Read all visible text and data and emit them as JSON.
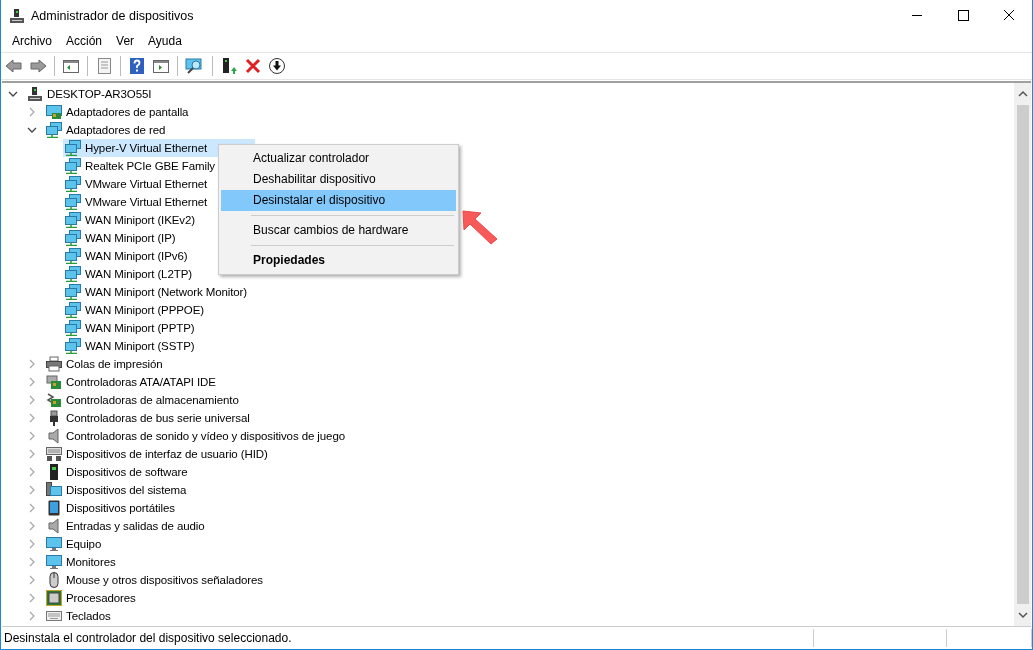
{
  "window": {
    "title": "Administrador de dispositivos"
  },
  "menu": [
    "Archivo",
    "Acción",
    "Ver",
    "Ayuda"
  ],
  "tree": {
    "label": "DESKTOP-AR3O55I",
    "kind": "computer",
    "expanded": true,
    "selected": false,
    "children": [
      {
        "label": "Adaptadores de pantalla",
        "kind": "display",
        "expanded": false,
        "selected": false
      },
      {
        "label": "Adaptadores de red",
        "kind": "network",
        "expanded": true,
        "selected": false,
        "children": [
          {
            "label": "Hyper-V Virtual Ethernet",
            "kind": "network",
            "selected": true
          },
          {
            "label": "Realtek PCIe GBE Family",
            "kind": "network",
            "selected": false
          },
          {
            "label": "VMware Virtual Ethernet",
            "kind": "network",
            "selected": false
          },
          {
            "label": "VMware Virtual Ethernet",
            "kind": "network",
            "selected": false
          },
          {
            "label": "WAN Miniport (IKEv2)",
            "kind": "network",
            "selected": false
          },
          {
            "label": "WAN Miniport (IP)",
            "kind": "network",
            "selected": false
          },
          {
            "label": "WAN Miniport (IPv6)",
            "kind": "network",
            "selected": false
          },
          {
            "label": "WAN Miniport (L2TP)",
            "kind": "network",
            "selected": false
          },
          {
            "label": "WAN Miniport (Network Monitor)",
            "kind": "network",
            "selected": false
          },
          {
            "label": "WAN Miniport (PPPOE)",
            "kind": "network",
            "selected": false
          },
          {
            "label": "WAN Miniport (PPTP)",
            "kind": "network",
            "selected": false
          },
          {
            "label": "WAN Miniport (SSTP)",
            "kind": "network",
            "selected": false
          }
        ]
      },
      {
        "label": "Colas de impresión",
        "kind": "printer",
        "expanded": false,
        "selected": false
      },
      {
        "label": "Controladoras ATA/ATAPI IDE",
        "kind": "card",
        "expanded": false,
        "selected": false
      },
      {
        "label": "Controladoras de almacenamiento",
        "kind": "storage",
        "expanded": false,
        "selected": false
      },
      {
        "label": "Controladoras de bus serie universal",
        "kind": "usb",
        "expanded": false,
        "selected": false
      },
      {
        "label": "Controladoras de sonido y vídeo y dispositivos de juego",
        "kind": "speaker",
        "expanded": false,
        "selected": false
      },
      {
        "label": "Dispositivos de interfaz de usuario (HID)",
        "kind": "hid",
        "expanded": false,
        "selected": false
      },
      {
        "label": "Dispositivos de software",
        "kind": "software",
        "expanded": false,
        "selected": false
      },
      {
        "label": "Dispositivos del sistema",
        "kind": "system",
        "expanded": false,
        "selected": false
      },
      {
        "label": "Dispositivos portátiles",
        "kind": "portable",
        "expanded": false,
        "selected": false
      },
      {
        "label": "Entradas y salidas de audio",
        "kind": "speaker",
        "expanded": false,
        "selected": false
      },
      {
        "label": "Equipo",
        "kind": "monitor",
        "expanded": false,
        "selected": false
      },
      {
        "label": "Monitores",
        "kind": "monitor",
        "expanded": false,
        "selected": false
      },
      {
        "label": "Mouse y otros dispositivos señaladores",
        "kind": "mouse",
        "expanded": false,
        "selected": false
      },
      {
        "label": "Procesadores",
        "kind": "cpu",
        "expanded": false,
        "selected": false
      },
      {
        "label": "Teclados",
        "kind": "keyboard",
        "expanded": false,
        "selected": false
      }
    ]
  },
  "context_menu": [
    {
      "kind": "item",
      "label": "Actualizar controlador",
      "selected": false,
      "bold": false
    },
    {
      "kind": "item",
      "label": "Deshabilitar dispositivo",
      "selected": false,
      "bold": false
    },
    {
      "kind": "item",
      "label": "Desinstalar el dispositivo",
      "selected": true,
      "bold": false
    },
    {
      "kind": "separator"
    },
    {
      "kind": "item",
      "label": "Buscar cambios de hardware",
      "selected": false,
      "bold": false
    },
    {
      "kind": "separator"
    },
    {
      "kind": "item",
      "label": "Propiedades",
      "selected": false,
      "bold": true
    }
  ],
  "status_bar": {
    "text": "Desinstala el controlador del dispositivo seleccionado."
  }
}
